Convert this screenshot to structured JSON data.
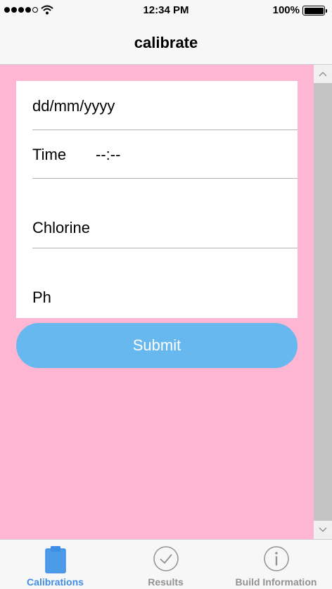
{
  "status_bar": {
    "time": "12:34 PM",
    "battery": "100%"
  },
  "nav": {
    "title": "calibrate"
  },
  "form": {
    "date_placeholder": "dd/mm/yyyy",
    "time_label": "Time",
    "time_value": "--:--",
    "chlorine_label": "Chlorine",
    "ph_label": "Ph",
    "submit_label": "Submit"
  },
  "tabs": [
    {
      "label": "Calibrations",
      "icon": "clipboard-icon",
      "active": true
    },
    {
      "label": "Results",
      "icon": "checkmark-circle-icon",
      "active": false
    },
    {
      "label": "Build Information",
      "icon": "info-icon",
      "active": false
    }
  ],
  "colors": {
    "content_background": "#ffb6d3",
    "submit_button": "#67b8ee",
    "active_tab": "#3f8ee6",
    "inactive_tab": "#929292"
  }
}
